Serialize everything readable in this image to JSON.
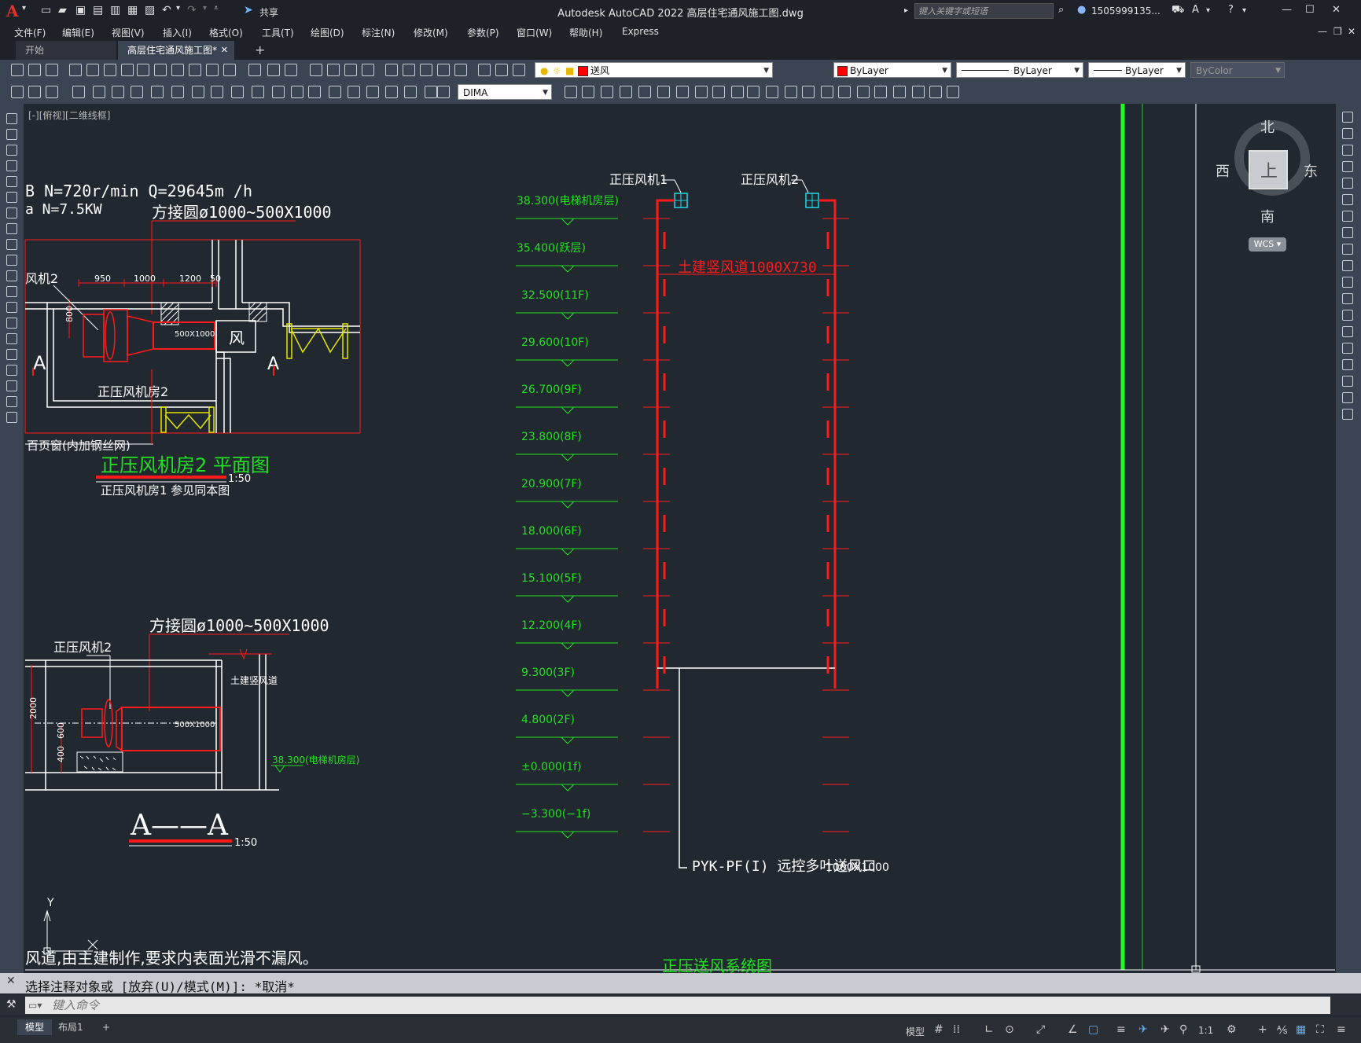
{
  "app": {
    "logo": "A",
    "title": "Autodesk AutoCAD 2022    高层住宅通风施工图.dwg",
    "share_label": "共享",
    "search_placeholder": "键入关键字或短语",
    "user": "1505999135...",
    "window_controls": [
      "—",
      "☐",
      "✕"
    ]
  },
  "menus": [
    "文件(F)",
    "编辑(E)",
    "视图(V)",
    "插入(I)",
    "格式(O)",
    "工具(T)",
    "绘图(D)",
    "标注(N)",
    "修改(M)",
    "参数(P)",
    "窗口(W)",
    "帮助(H)",
    "Express"
  ],
  "tabs": {
    "start": "开始",
    "drawing": "高层住宅通风施工图*",
    "close": "✕",
    "add": "+"
  },
  "toolbar": {
    "layer": "送风",
    "color": "ByLayer",
    "linetype": "ByLayer",
    "lineweight": "ByLayer",
    "plotstyle": "ByColor",
    "dimstyle": "DIMA"
  },
  "viewport_label": "[-][俯视][二维线框]",
  "viewcube": {
    "north": "北",
    "south": "南",
    "east": "东",
    "west": "西",
    "top": "上",
    "wcs": "WCS"
  },
  "drawing": {
    "plan": {
      "fan_spec_1": "B  N=720r/min  Q=29645m /h",
      "fan_spec_2": "a  N=7.5KW",
      "transition": "方接圆ø1000~500X1000",
      "fan_label": "风机2",
      "dims": [
        "950",
        "1000",
        "1200",
        "50"
      ],
      "dim_800": "800",
      "duct_size": "500X1000",
      "feng": "风",
      "sec_a": "A",
      "room": "正压风机房2",
      "louver": "百页窗(内加钢丝网)",
      "title": "正压风机房2 平面图",
      "scale": "1:50",
      "note": "正压风机房1 参见同本图"
    },
    "section": {
      "transition": "方接圆ø1000~500X1000",
      "fan_label": "正压风机2",
      "shaft": "土建竖风道",
      "duct_size": "500X1000",
      "dim_2000": "2000",
      "dim_600": "600",
      "dim_400": "400",
      "elev": "38.300(电梯机房层)",
      "title": "A——A",
      "scale": "1:50"
    },
    "system": {
      "fan1": "正压风机1",
      "fan2": "正压风机2",
      "shaft": "土建竖风道1000X730",
      "levels": [
        "38.300(电梯机房层)",
        "35.400(跃层)",
        "32.500(11F)",
        "29.600(10F)",
        "26.700(9F)",
        "23.800(8F)",
        "20.900(7F)",
        "18.000(6F)",
        "15.100(5F)",
        "12.200(4F)",
        "9.300(3F)",
        "4.800(2F)",
        "±0.000(1f)",
        "−3.300(−1f)"
      ],
      "damper": "PYK-PF(I) 远控多叶送风口",
      "damper_size": "1000X1000",
      "title": "正压送风系统图"
    },
    "bottom_note": "风道,由主建制作,要求内表面光滑不漏风。",
    "ucs_y": "Y"
  },
  "command": {
    "history": "选择注释对象或 [放弃(U)/模式(M)]: *取消*",
    "placeholder": "键入命令"
  },
  "status": {
    "model_tab": "模型",
    "layout_tab": "布局1",
    "add": "+",
    "model_btn": "模型",
    "scale": "1:1"
  },
  "colors": {
    "canvas": "#212830",
    "green": "#20e020",
    "red": "#ff1a1a",
    "yellow": "#e6e600",
    "cyan": "#22d8e8",
    "white": "#ffffff"
  }
}
